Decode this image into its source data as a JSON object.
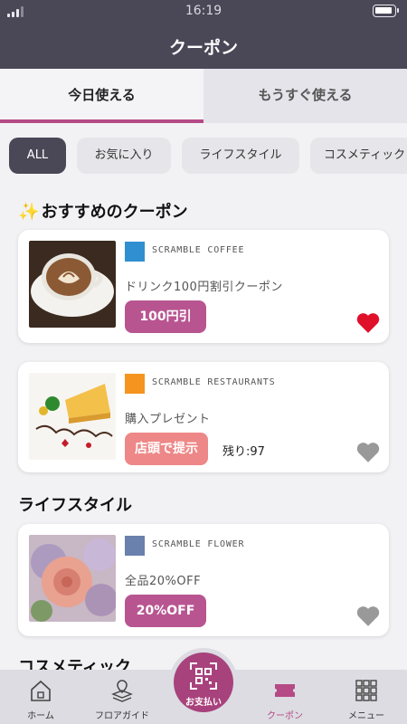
{
  "status": {
    "time": "16:19"
  },
  "header": {
    "title": "クーポン"
  },
  "tabs": [
    {
      "label": "今日使える",
      "active": true
    },
    {
      "label": "もうすぐ使える",
      "active": false
    }
  ],
  "filters": [
    {
      "label": "ALL",
      "active": true
    },
    {
      "label": "お気に入り",
      "active": false
    },
    {
      "label": "ライフスタイル",
      "active": false
    },
    {
      "label": "コスメティック",
      "active": false
    }
  ],
  "sections": {
    "recommended": "おすすめのクーポン",
    "lifestyle": "ライフスタイル",
    "cosmetic": "コスメティック"
  },
  "coupons": [
    {
      "shop": "SCRAMBLE COFFEE",
      "logo_color": "#2f8fd0",
      "description": "ドリンク100円割引クーポン",
      "button": "100円引",
      "button_color": "#b85591",
      "remaining": "",
      "favorite": true,
      "image": "coffee-latte-photo"
    },
    {
      "shop": "SCRAMBLE RESTAURANTS",
      "logo_color": "#f5941f",
      "description": "購入プレゼント",
      "button": "店頭で提示",
      "button_color": "#ee8787",
      "remaining": "残り:97",
      "favorite": false,
      "image": "birthday-cake-photo"
    },
    {
      "shop": "SCRAMBLE FLOWER",
      "logo_color": "#6a80ad",
      "description": "全品20%OFF",
      "button": "20%OFF",
      "button_color": "#b85591",
      "remaining": "",
      "favorite": false,
      "image": "flower-bouquet-photo"
    }
  ],
  "colors": {
    "accent": "#b54a86",
    "header_bg": "#4a4857",
    "heart_active": "#e0102a",
    "heart_inactive": "#999999"
  },
  "bottom_nav": [
    {
      "label": "ホーム",
      "icon": "home-icon",
      "active": false
    },
    {
      "label": "フロアガイド",
      "icon": "floor-guide-icon",
      "active": false
    },
    {
      "label": "お支払い",
      "icon": "qr-code-icon",
      "active": false
    },
    {
      "label": "クーポン",
      "icon": "coupon-icon",
      "active": true
    },
    {
      "label": "メニュー",
      "icon": "menu-grid-icon",
      "active": false
    }
  ]
}
